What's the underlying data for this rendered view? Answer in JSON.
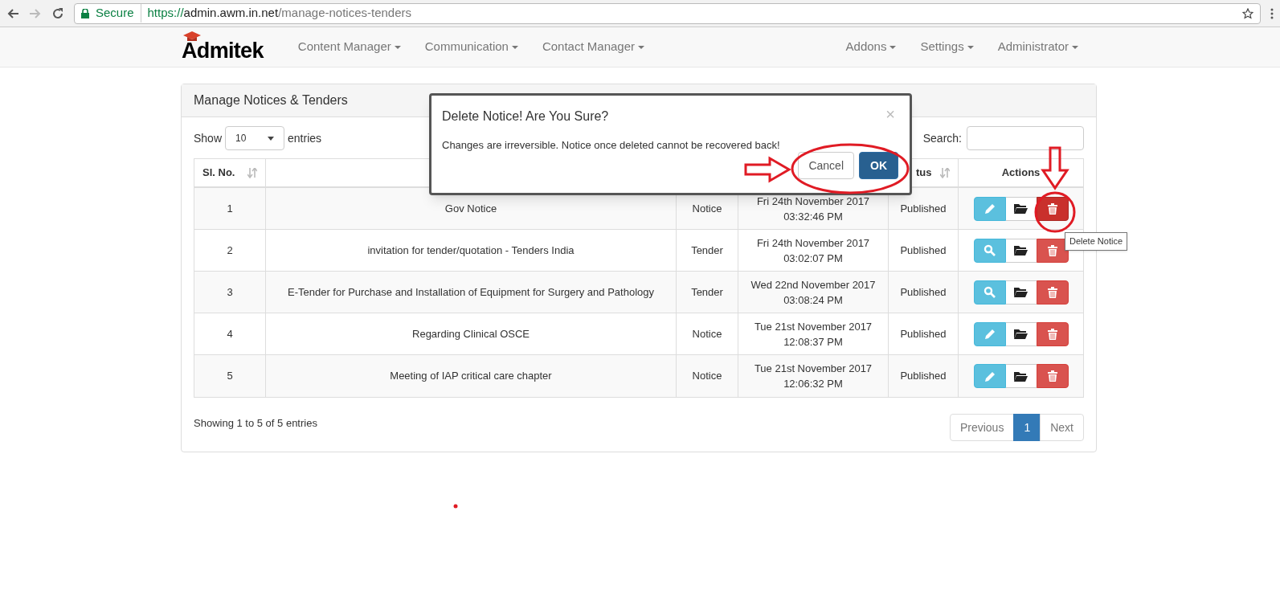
{
  "browser": {
    "security": "Secure",
    "url_scheme": "https://",
    "url_host": "admin.awm.in.net",
    "url_path": "/manage-notices-tenders"
  },
  "navbar": {
    "brand": "Admitek",
    "left_menus": [
      "Content Manager",
      "Communication",
      "Contact Manager"
    ],
    "right_menus": [
      "Addons",
      "Settings",
      "Administrator"
    ]
  },
  "panel": {
    "title": "Manage Notices & Tenders",
    "show_label": "Show",
    "page_size": "10",
    "entries_label": "entries",
    "search_label": "Search:"
  },
  "table": {
    "columns": [
      {
        "label": "Sl. No.",
        "sortable": true
      },
      {
        "label": "tus",
        "sortable": true
      },
      {
        "label": "Actions",
        "sortable": false
      }
    ],
    "rows": [
      {
        "no": "1",
        "title": "Gov Notice",
        "type": "Notice",
        "date": "Fri 24th November 2017",
        "time": "03:32:46 PM",
        "status": "Published",
        "kind": "edit",
        "delete_active": true
      },
      {
        "no": "2",
        "title": "invitation for tender/quotation - Tenders India",
        "type": "Tender",
        "date": "Fri 24th November 2017",
        "time": "03:02:07 PM",
        "status": "Published",
        "kind": "view",
        "delete_active": false
      },
      {
        "no": "3",
        "title": "E-Tender for Purchase and Installation of Equipment for Surgery and Pathology",
        "type": "Tender",
        "date": "Wed 22nd November 2017",
        "time": "03:08:24 PM",
        "status": "Published",
        "kind": "view",
        "delete_active": false
      },
      {
        "no": "4",
        "title": "Regarding Clinical OSCE",
        "type": "Notice",
        "date": "Tue 21st November 2017",
        "time": "12:08:37 PM",
        "status": "Published",
        "kind": "edit",
        "delete_active": false
      },
      {
        "no": "5",
        "title": "Meeting of IAP critical care chapter",
        "type": "Notice",
        "date": "Tue 21st November 2017",
        "time": "12:06:32 PM",
        "status": "Published",
        "kind": "edit",
        "delete_active": false
      }
    ],
    "info": "Showing 1 to 5 of 5 entries"
  },
  "pagination": [
    {
      "label": "Previous",
      "selected": false
    },
    {
      "label": "1",
      "selected": true
    },
    {
      "label": "Next",
      "selected": false
    }
  ],
  "tooltip": "Delete Notice",
  "dialog": {
    "title": "Delete Notice! Are You Sure?",
    "message": "Changes are irreversible. Notice once deleted cannot be recovered back!",
    "close": "×",
    "cancel": "Cancel",
    "ok": "OK"
  }
}
